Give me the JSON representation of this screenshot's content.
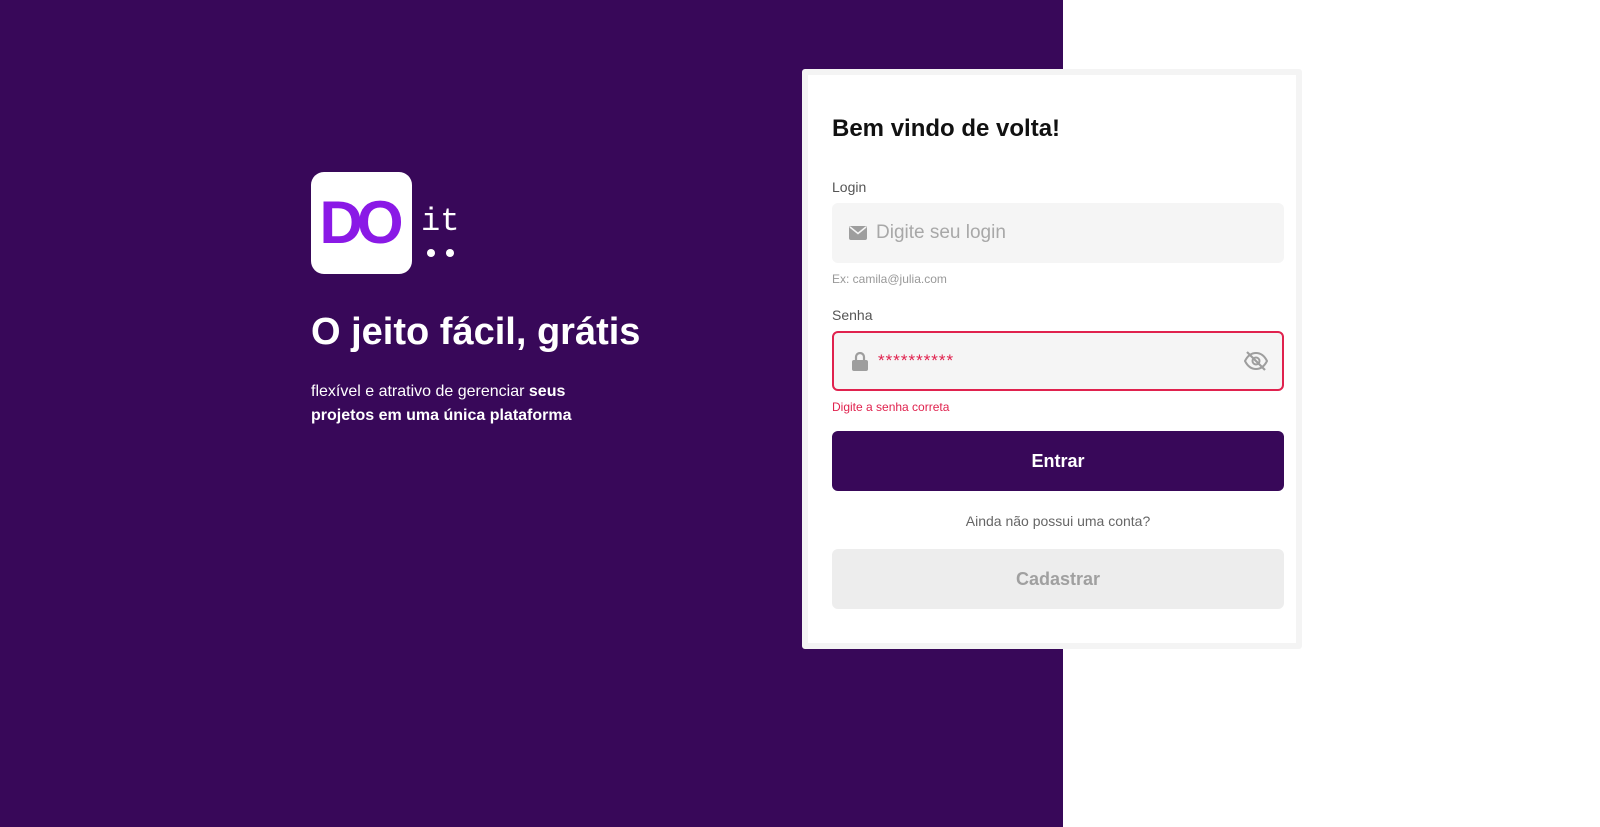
{
  "brand": {
    "logo_mark": "DO",
    "logo_suffix": "it",
    "headline": "O jeito fácil, grátis",
    "tagline_regular": "flexível e atrativo de gerenciar ",
    "tagline_bold": "seus projetos em uma única plataforma"
  },
  "login_form": {
    "title": "Bem vindo de volta!",
    "login_label": "Login",
    "login_placeholder": "Digite seu login",
    "login_hint": "Ex: camila@julia.com",
    "password_label": "Senha",
    "password_value": "**********",
    "password_error": "Digite a senha correta",
    "submit_label": "Entrar",
    "no_account_text": "Ainda não possui uma conta?",
    "register_label": "Cadastrar"
  },
  "icons": {
    "login": "envelope-icon",
    "password": "lock-icon",
    "toggle_visibility": "eye-off-icon"
  },
  "colors": {
    "brand_purple": "#380859",
    "logo_purple": "#8a19e6",
    "error_red": "#e0224e"
  }
}
